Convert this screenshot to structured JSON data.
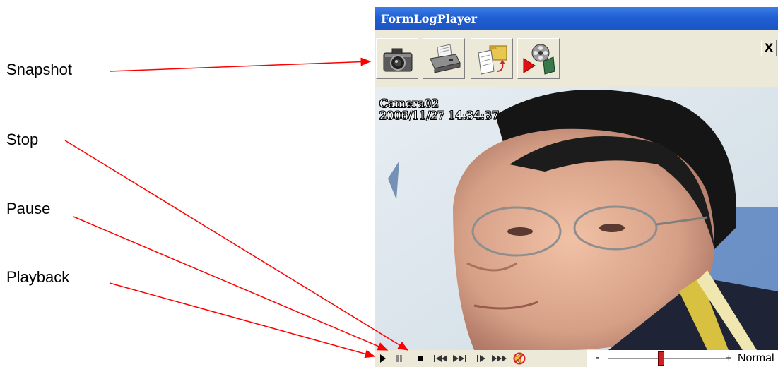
{
  "annotations": {
    "snapshot": "Snapshot",
    "stop": "Stop",
    "pause": "Pause",
    "playback": "Playback"
  },
  "window": {
    "title": "FormLogPlayer",
    "close_label": "X"
  },
  "toolbar": {
    "buttons": [
      "camera-icon",
      "printer-icon",
      "open-folder-icon",
      "film-reel-icon"
    ]
  },
  "video": {
    "camera_name": "Camera02",
    "timestamp": "2006/11/27 14:34:37"
  },
  "controls": {
    "speed_label": "Normal",
    "speed_min": "-",
    "speed_max": "+"
  },
  "colors": {
    "titlebar": "#1f5fd3",
    "arrow": "#ff0000",
    "panel": "#ece9d8"
  }
}
